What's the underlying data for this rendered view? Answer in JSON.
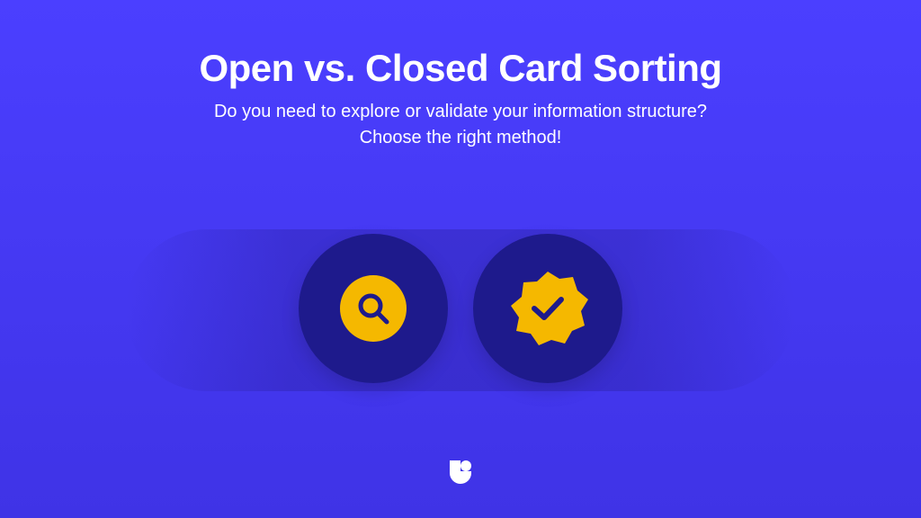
{
  "header": {
    "title": "Open vs. Closed Card Sorting",
    "subtitle_line1": "Do you need to explore or validate your information structure?",
    "subtitle_line2": "Choose the right method!"
  },
  "icons": {
    "left": "search-icon",
    "right": "verified-badge-icon"
  },
  "colors": {
    "background_top": "#4B3FFF",
    "background_bottom": "#3F33E6",
    "circle": "#1E1A8C",
    "accent_yellow": "#F5B800",
    "text": "#FFFFFF"
  },
  "logo": "brand-logo"
}
